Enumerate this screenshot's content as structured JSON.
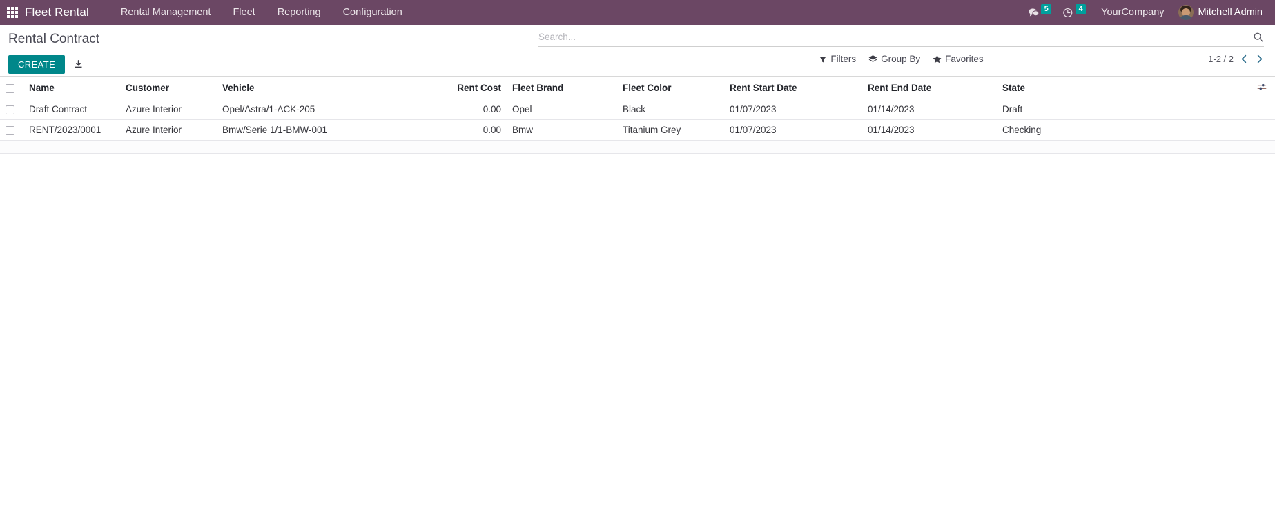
{
  "navbar": {
    "apps_icon": "apps-grid-icon",
    "brand": "Fleet Rental",
    "menu": [
      {
        "label": "Rental Management"
      },
      {
        "label": "Fleet"
      },
      {
        "label": "Reporting"
      },
      {
        "label": "Configuration"
      }
    ],
    "messages": {
      "icon": "messages-icon",
      "count": "5"
    },
    "activities": {
      "icon": "clock-icon",
      "count": "4"
    },
    "company": "YourCompany",
    "user": {
      "name": "Mitchell Admin",
      "avatar": "user-avatar"
    },
    "bg_color": "#6b4764",
    "badge_color": "#00a09d"
  },
  "control_panel": {
    "title": "Rental Contract",
    "create_label": "CREATE",
    "create_color": "#00878a",
    "import_icon": "import-icon",
    "search": {
      "placeholder": "Search...",
      "value": "",
      "icon": "search-icon"
    },
    "filter_buttons": [
      {
        "label": "Filters",
        "icon": "filter-icon"
      },
      {
        "label": "Group By",
        "icon": "layers-icon"
      },
      {
        "label": "Favorites",
        "icon": "star-icon"
      }
    ],
    "pager": {
      "range": "1-2 / 2",
      "prev_icon": "chevron-left-icon",
      "next_icon": "chevron-right-icon"
    }
  },
  "list": {
    "select_all_checkbox": "select-all-checkbox",
    "options_icon": "column-options-icon",
    "columns": [
      {
        "key": "name",
        "label": "Name",
        "align": "left"
      },
      {
        "key": "customer",
        "label": "Customer",
        "align": "left"
      },
      {
        "key": "vehicle",
        "label": "Vehicle",
        "align": "left"
      },
      {
        "key": "rent_cost",
        "label": "Rent Cost",
        "align": "right"
      },
      {
        "key": "fleet_brand",
        "label": "Fleet Brand",
        "align": "left"
      },
      {
        "key": "fleet_color",
        "label": "Fleet Color",
        "align": "left"
      },
      {
        "key": "rent_start",
        "label": "Rent Start Date",
        "align": "left"
      },
      {
        "key": "rent_end",
        "label": "Rent End Date",
        "align": "left"
      },
      {
        "key": "state",
        "label": "State",
        "align": "left"
      }
    ],
    "rows": [
      {
        "highlight": true,
        "name": "Draft Contract",
        "customer": "Azure Interior",
        "vehicle": "Opel/Astra/1-ACK-205",
        "rent_cost": "0.00",
        "fleet_brand": "Opel",
        "fleet_color": "Black",
        "rent_start": "01/07/2023",
        "rent_end": "01/14/2023",
        "state": "Draft"
      },
      {
        "highlight": false,
        "name": "RENT/2023/0001",
        "customer": "Azure Interior",
        "vehicle": "Bmw/Serie 1/1-BMW-001",
        "rent_cost": "0.00",
        "fleet_brand": "Bmw",
        "fleet_color": "Titanium Grey",
        "rent_start": "01/07/2023",
        "rent_end": "01/14/2023",
        "state": "Checking"
      }
    ],
    "link_color": "#017e84"
  }
}
